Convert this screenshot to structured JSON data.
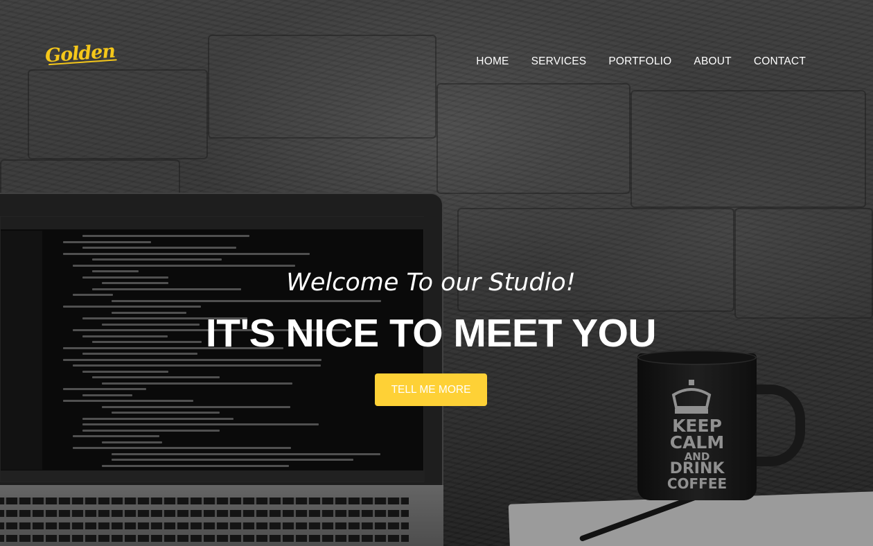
{
  "brand": {
    "logo_text": "Golden",
    "accent_color": "#fed136"
  },
  "nav": {
    "items": [
      {
        "label": "HOME"
      },
      {
        "label": "SERVICES"
      },
      {
        "label": "PORTFOLIO"
      },
      {
        "label": "ABOUT"
      },
      {
        "label": "CONTACT"
      }
    ]
  },
  "hero": {
    "subheading": "Welcome To our Studio!",
    "heading": "IT'S NICE TO MEET YOU",
    "cta_label": "TELL ME MORE"
  },
  "background": {
    "mug_lines": [
      "KEEP",
      "CALM",
      "AND",
      "DRINK",
      "COFFEE"
    ]
  }
}
